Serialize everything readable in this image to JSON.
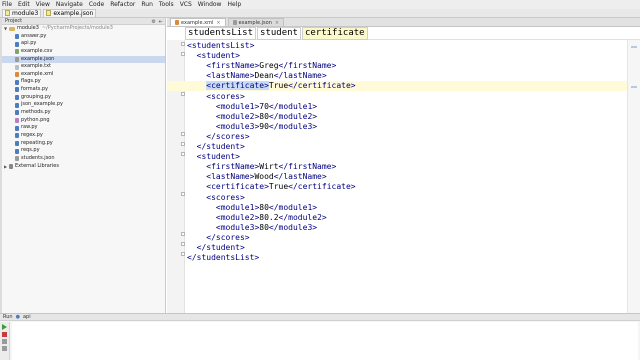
{
  "menubar": {
    "items": [
      "File",
      "Edit",
      "View",
      "Navigate",
      "Code",
      "Refactor",
      "Run",
      "Tools",
      "VCS",
      "Window",
      "Help"
    ]
  },
  "navbar": {
    "crumbs": [
      "module3",
      "example.json"
    ]
  },
  "project_panel": {
    "title": "Project",
    "root": {
      "name": "module3",
      "path": "~/PycharmProjects/module3"
    },
    "files": [
      {
        "name": "answer.py",
        "icon": "py"
      },
      {
        "name": "api.py",
        "icon": "py"
      },
      {
        "name": "example.csv",
        "icon": "csv"
      },
      {
        "name": "example.json",
        "icon": "json",
        "selected": true
      },
      {
        "name": "example.txt",
        "icon": "txt"
      },
      {
        "name": "example.xml",
        "icon": "xml"
      },
      {
        "name": "flags.py",
        "icon": "py"
      },
      {
        "name": "formats.py",
        "icon": "py"
      },
      {
        "name": "grouping.py",
        "icon": "py"
      },
      {
        "name": "json_example.py",
        "icon": "py"
      },
      {
        "name": "methods.py",
        "icon": "py"
      },
      {
        "name": "python.png",
        "icon": "png"
      },
      {
        "name": "raw.py",
        "icon": "py"
      },
      {
        "name": "regex.py",
        "icon": "py"
      },
      {
        "name": "repeating.py",
        "icon": "py"
      },
      {
        "name": "reqs.py",
        "icon": "py"
      },
      {
        "name": "students.json",
        "icon": "json"
      }
    ],
    "external": "External Libraries"
  },
  "editor": {
    "tabs": [
      {
        "label": "example.xml",
        "active": true
      },
      {
        "label": "example.json",
        "active": false
      }
    ],
    "tag_breadcrumb": [
      "studentsList",
      "student",
      "certificate"
    ],
    "lines": [
      {
        "indent": 0,
        "parts": [
          {
            "t": "tag",
            "v": "<studentsList>"
          }
        ]
      },
      {
        "indent": 2,
        "parts": [
          {
            "t": "tag",
            "v": "<student>"
          }
        ]
      },
      {
        "indent": 4,
        "parts": [
          {
            "t": "tag",
            "v": "<firstName>"
          },
          {
            "t": "txt",
            "v": "Greg"
          },
          {
            "t": "tag",
            "v": "</firstName>"
          }
        ]
      },
      {
        "indent": 4,
        "parts": [
          {
            "t": "tag",
            "v": "<lastName>"
          },
          {
            "t": "txt",
            "v": "Dean"
          },
          {
            "t": "tag",
            "v": "</lastName>"
          }
        ]
      },
      {
        "indent": 4,
        "current": true,
        "parts": [
          {
            "t": "tag",
            "v": "<certificate>"
          },
          {
            "t": "txt",
            "v": "True"
          },
          {
            "t": "tag",
            "v": "</certificate>"
          }
        ]
      },
      {
        "indent": 4,
        "parts": [
          {
            "t": "tag",
            "v": "<scores>"
          }
        ]
      },
      {
        "indent": 6,
        "parts": [
          {
            "t": "tag",
            "v": "<module1>"
          },
          {
            "t": "txt",
            "v": "70"
          },
          {
            "t": "tag",
            "v": "</module1>"
          }
        ]
      },
      {
        "indent": 6,
        "parts": [
          {
            "t": "tag",
            "v": "<module2>"
          },
          {
            "t": "txt",
            "v": "80"
          },
          {
            "t": "tag",
            "v": "</module2>"
          }
        ]
      },
      {
        "indent": 6,
        "parts": [
          {
            "t": "tag",
            "v": "<module3>"
          },
          {
            "t": "txt",
            "v": "90"
          },
          {
            "t": "tag",
            "v": "</module3>"
          }
        ]
      },
      {
        "indent": 4,
        "parts": [
          {
            "t": "tag",
            "v": "</scores>"
          }
        ]
      },
      {
        "indent": 2,
        "parts": [
          {
            "t": "tag",
            "v": "</student>"
          }
        ]
      },
      {
        "indent": 2,
        "parts": [
          {
            "t": "tag",
            "v": "<student>"
          }
        ]
      },
      {
        "indent": 4,
        "parts": [
          {
            "t": "tag",
            "v": "<firstName>"
          },
          {
            "t": "txt",
            "v": "Wirt"
          },
          {
            "t": "tag",
            "v": "</firstName>"
          }
        ]
      },
      {
        "indent": 4,
        "parts": [
          {
            "t": "tag",
            "v": "<lastName>"
          },
          {
            "t": "txt",
            "v": "Wood"
          },
          {
            "t": "tag",
            "v": "</lastName>"
          }
        ]
      },
      {
        "indent": 4,
        "parts": [
          {
            "t": "tag",
            "v": "<certificate>"
          },
          {
            "t": "txt",
            "v": "True"
          },
          {
            "t": "tag",
            "v": "</certificate>"
          }
        ]
      },
      {
        "indent": 4,
        "parts": [
          {
            "t": "tag",
            "v": "<scores>"
          }
        ]
      },
      {
        "indent": 6,
        "parts": [
          {
            "t": "tag",
            "v": "<module1>"
          },
          {
            "t": "txt",
            "v": "80"
          },
          {
            "t": "tag",
            "v": "</module1>"
          }
        ]
      },
      {
        "indent": 6,
        "parts": [
          {
            "t": "tag",
            "v": "<module2>"
          },
          {
            "t": "txt",
            "v": "80.2"
          },
          {
            "t": "tag",
            "v": "</module2>"
          }
        ]
      },
      {
        "indent": 6,
        "parts": [
          {
            "t": "tag",
            "v": "<module3>"
          },
          {
            "t": "txt",
            "v": "80"
          },
          {
            "t": "tag",
            "v": "</module3>"
          }
        ]
      },
      {
        "indent": 4,
        "parts": [
          {
            "t": "tag",
            "v": "</scores>"
          }
        ]
      },
      {
        "indent": 2,
        "parts": [
          {
            "t": "tag",
            "v": "</student>"
          }
        ]
      },
      {
        "indent": 0,
        "parts": [
          {
            "t": "tag",
            "v": "</studentsList>"
          }
        ]
      }
    ]
  },
  "run_panel": {
    "label": "Run",
    "config": "api"
  },
  "colors": {
    "tag": "#000080",
    "current_line": "#fffbd8",
    "selection": "#c9d8ee"
  }
}
